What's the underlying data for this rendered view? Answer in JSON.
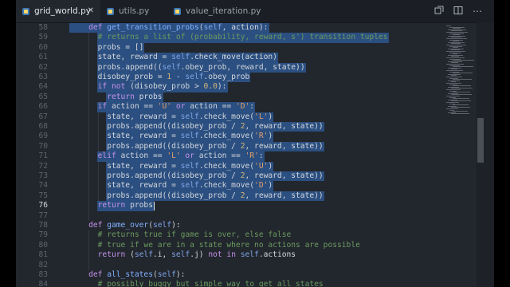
{
  "tabs": [
    {
      "label": "grid_world.py",
      "active": true
    },
    {
      "label": "utils.py",
      "active": false
    },
    {
      "label": "value_iteration.py",
      "active": false
    }
  ],
  "toolbar_icons": [
    "split-diff-icon",
    "split-editor-icon",
    "more-icon"
  ],
  "editor": {
    "current_line": 76,
    "lines": [
      {
        "n": 58,
        "t": [
          [
            "    ",
            ""
          ],
          [
            "def ",
            "kw"
          ],
          [
            "get_transition_probs",
            "fn"
          ],
          [
            "(",
            "op"
          ],
          [
            "self",
            "slf"
          ],
          [
            ", action):",
            ""
          ]
        ]
      },
      {
        "n": 59,
        "t": [
          [
            "      ",
            ""
          ],
          [
            "# returns a list of (probability, reward, s') transition tuples",
            "cm"
          ]
        ]
      },
      {
        "n": 60,
        "t": [
          [
            "      probs = []",
            ""
          ]
        ]
      },
      {
        "n": 61,
        "t": [
          [
            "      state, reward = ",
            ""
          ],
          [
            "self",
            "slf"
          ],
          [
            ".check_move(action)",
            ""
          ]
        ]
      },
      {
        "n": 62,
        "t": [
          [
            "      probs.append((",
            ""
          ],
          [
            "self",
            "slf"
          ],
          [
            ".obey_prob, reward, state))",
            ""
          ]
        ]
      },
      {
        "n": 63,
        "t": [
          [
            "      disobey_prob = ",
            ""
          ],
          [
            "1",
            "num"
          ],
          [
            " - ",
            ""
          ],
          [
            "self",
            "slf"
          ],
          [
            ".obey_prob",
            ""
          ]
        ]
      },
      {
        "n": 64,
        "t": [
          [
            "      ",
            ""
          ],
          [
            "if not ",
            "kw"
          ],
          [
            "(disobey_prob > ",
            ""
          ],
          [
            "0.0",
            "num"
          ],
          [
            "):",
            ""
          ]
        ]
      },
      {
        "n": 65,
        "t": [
          [
            "        ",
            ""
          ],
          [
            "return ",
            "kw"
          ],
          [
            "probs",
            ""
          ]
        ]
      },
      {
        "n": 66,
        "t": [
          [
            "      ",
            ""
          ],
          [
            "if ",
            "kw"
          ],
          [
            "action == ",
            ""
          ],
          [
            "'U'",
            "str"
          ],
          [
            " or ",
            "kw"
          ],
          [
            "action == ",
            ""
          ],
          [
            "'D'",
            "str"
          ],
          [
            ":",
            ""
          ]
        ]
      },
      {
        "n": 67,
        "t": [
          [
            "        state, reward = ",
            ""
          ],
          [
            "self",
            "slf"
          ],
          [
            ".check_move(",
            ""
          ],
          [
            "'L'",
            "str"
          ],
          [
            ")",
            ""
          ]
        ]
      },
      {
        "n": 68,
        "t": [
          [
            "        probs.append((disobey_prob / ",
            ""
          ],
          [
            "2",
            "num"
          ],
          [
            ", reward, state))",
            ""
          ]
        ]
      },
      {
        "n": 69,
        "t": [
          [
            "        state, reward = ",
            ""
          ],
          [
            "self",
            "slf"
          ],
          [
            ".check_move(",
            ""
          ],
          [
            "'R'",
            "str"
          ],
          [
            ")",
            ""
          ]
        ]
      },
      {
        "n": 70,
        "t": [
          [
            "        probs.append((disobey_prob / ",
            ""
          ],
          [
            "2",
            "num"
          ],
          [
            ", reward, state))",
            ""
          ]
        ]
      },
      {
        "n": 71,
        "t": [
          [
            "      ",
            ""
          ],
          [
            "elif ",
            "kw"
          ],
          [
            "action == ",
            ""
          ],
          [
            "'L'",
            "str"
          ],
          [
            " or ",
            "kw"
          ],
          [
            "action == ",
            ""
          ],
          [
            "'R'",
            "str"
          ],
          [
            ":",
            ""
          ]
        ]
      },
      {
        "n": 72,
        "t": [
          [
            "        state, reward = ",
            ""
          ],
          [
            "self",
            "slf"
          ],
          [
            ".check_move(",
            ""
          ],
          [
            "'U'",
            "str"
          ],
          [
            ")",
            ""
          ]
        ]
      },
      {
        "n": 73,
        "t": [
          [
            "        probs.append((disobey_prob / ",
            ""
          ],
          [
            "2",
            "num"
          ],
          [
            ", reward, state))",
            ""
          ]
        ]
      },
      {
        "n": 74,
        "t": [
          [
            "        state, reward = ",
            ""
          ],
          [
            "self",
            "slf"
          ],
          [
            ".check_move(",
            ""
          ],
          [
            "'D'",
            "str"
          ],
          [
            ")",
            ""
          ]
        ]
      },
      {
        "n": 75,
        "t": [
          [
            "        probs.append((disobey_prob / ",
            ""
          ],
          [
            "2",
            "num"
          ],
          [
            ", reward, state))",
            ""
          ]
        ]
      },
      {
        "n": 76,
        "t": [
          [
            "      ",
            ""
          ],
          [
            "return ",
            "kw"
          ],
          [
            "probs",
            ""
          ]
        ]
      },
      {
        "n": 77,
        "t": [
          [
            "",
            ""
          ]
        ]
      },
      {
        "n": 78,
        "t": [
          [
            "    ",
            ""
          ],
          [
            "def ",
            "kw"
          ],
          [
            "game_over",
            "fn"
          ],
          [
            "(",
            "op"
          ],
          [
            "self",
            "slf"
          ],
          [
            "):",
            ""
          ]
        ]
      },
      {
        "n": 79,
        "t": [
          [
            "      ",
            ""
          ],
          [
            "# returns true if game is over, else false",
            "cm"
          ]
        ]
      },
      {
        "n": 80,
        "t": [
          [
            "      ",
            ""
          ],
          [
            "# true if we are in a state where no actions are possible",
            "cm"
          ]
        ]
      },
      {
        "n": 81,
        "t": [
          [
            "      ",
            ""
          ],
          [
            "return ",
            "kw"
          ],
          [
            "(",
            ""
          ],
          [
            "self",
            "slf"
          ],
          [
            ".i, ",
            ""
          ],
          [
            "self",
            "slf"
          ],
          [
            ".j) ",
            ""
          ],
          [
            "not in ",
            "kw"
          ],
          [
            "self",
            "slf"
          ],
          [
            ".actions",
            ""
          ]
        ]
      },
      {
        "n": 82,
        "t": [
          [
            "",
            ""
          ]
        ]
      },
      {
        "n": 83,
        "t": [
          [
            "    ",
            ""
          ],
          [
            "def ",
            "kw"
          ],
          [
            "all_states",
            "fn"
          ],
          [
            "(",
            "op"
          ],
          [
            "self",
            "slf"
          ],
          [
            "):",
            ""
          ]
        ]
      },
      {
        "n": 84,
        "t": [
          [
            "      ",
            ""
          ],
          [
            "# possibly buggy but simple way to get all states",
            "cm"
          ]
        ]
      }
    ]
  }
}
